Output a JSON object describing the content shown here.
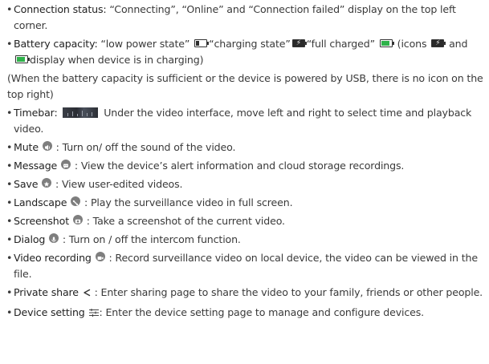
{
  "items": [
    {
      "term": "Connection status:",
      "text": " “Connecting”, “Online” and “Connection failed” display on the top left corner."
    },
    {
      "term": "Battery capacity:",
      "text_a": " “low power state”",
      "text_b": "“charging state”",
      "text_c": "“full charged”",
      "text_d": " (icons",
      "text_e": "and",
      "text_f": "display when device is in charging)"
    },
    {
      "note": "(When the battery capacity is sufficient or the device is powered by USB, there is no icon on the top right)"
    },
    {
      "term": "Timebar:",
      "text": " Under the video interface, move left and right to select time and playback video."
    },
    {
      "term": "Mute",
      "text": " : Turn on/ off the sound of the video.",
      "icon": "speaker-icon"
    },
    {
      "term": "Message",
      "text": " : View the device’s alert information and cloud storage recordings.",
      "icon": "message-icon"
    },
    {
      "term": "Save",
      "text": " : View user-edited videos.",
      "icon": "star-icon"
    },
    {
      "term": "Landscape",
      "text": " : Play the surveillance video in full screen.",
      "icon": "landscape-icon"
    },
    {
      "term": "Screenshot",
      "text": " : Take a screenshot of the current video.",
      "icon": "camera-icon"
    },
    {
      "term": "Dialog",
      "text": " : Turn on / off the intercom function.",
      "icon": "microphone-icon"
    },
    {
      "term": "Video recording",
      "text": " : Record surveillance video on local device, the video can be viewed in the file.",
      "icon": "video-recording-icon"
    },
    {
      "term": "Private share",
      "text": " : Enter sharing page to share the video to your family, friends or other people.",
      "icon": "share-icon"
    },
    {
      "term": "Device setting",
      "text": ": Enter the device setting page to manage and configure devices.",
      "icon": "settings-sliders-icon"
    }
  ],
  "colors": {
    "text": "#3a3a3a",
    "battery_full": "#2fb24a",
    "icon_gray": "#7e7e7e"
  }
}
